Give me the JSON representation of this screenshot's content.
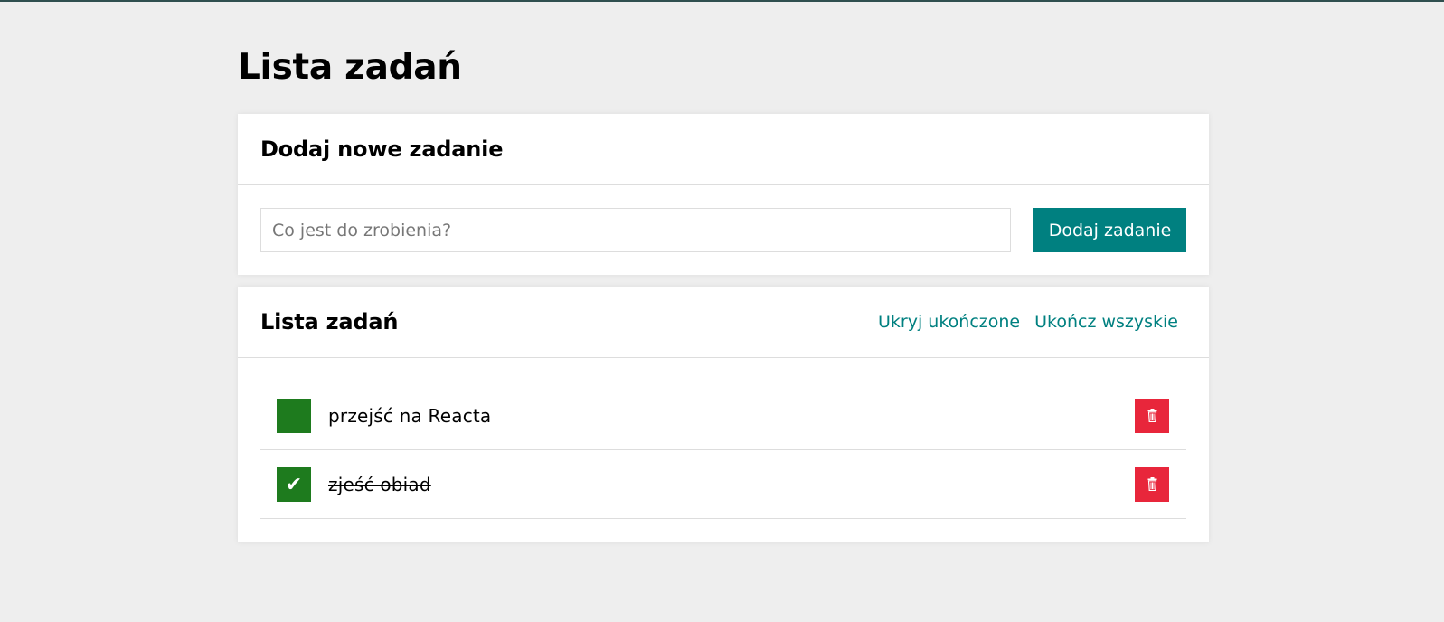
{
  "page": {
    "title": "Lista zadań"
  },
  "add_section": {
    "title": "Dodaj nowe zadanie",
    "input_placeholder": "Co jest do zrobienia?",
    "input_value": "",
    "button_label": "Dodaj zadanie"
  },
  "list_section": {
    "title": "Lista zadań",
    "hide_done_label": "Ukryj ukończone",
    "complete_all_label": "Ukończ wszyskie",
    "tasks": [
      {
        "content": "przejść na Reacta",
        "done": false,
        "toggle_icon": ""
      },
      {
        "content": "zjeść obiad",
        "done": true,
        "toggle_icon": "✔"
      }
    ]
  },
  "colors": {
    "accent": "#008080",
    "toggle_green": "#1e7b1e",
    "delete_red": "#e8263b",
    "background": "#eeeeee"
  },
  "icons": {
    "done": "check-icon",
    "remove": "trash-icon"
  }
}
